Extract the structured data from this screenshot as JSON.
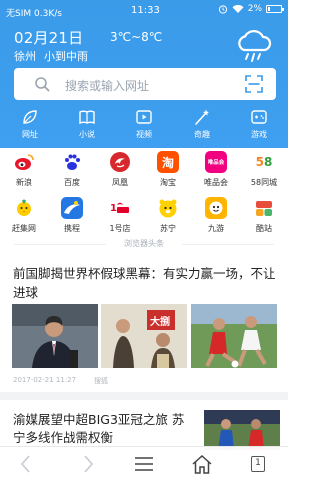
{
  "status_bar": {
    "carrier": "无SIM",
    "speed": "0.3K/s",
    "time": "11:33",
    "battery": "2%"
  },
  "weather": {
    "date": "02月21日",
    "temperature": "3℃~8℃",
    "city": "徐州",
    "condition": "小到中雨",
    "icon": "cloud-rain-icon"
  },
  "search": {
    "placeholder": "搜索或输入网址"
  },
  "nav": [
    {
      "label": "网址",
      "icon": "leaf-icon"
    },
    {
      "label": "小说",
      "icon": "book-icon"
    },
    {
      "label": "视频",
      "icon": "video-icon"
    },
    {
      "label": "奇趣",
      "icon": "magic-icon"
    },
    {
      "label": "游戏",
      "icon": "gamepad-icon"
    }
  ],
  "apps": [
    {
      "label": "新浪",
      "color": "#e6162d",
      "icon": "weibo-icon"
    },
    {
      "label": "百度",
      "color": "#2932e1",
      "icon": "baidu-paw-icon"
    },
    {
      "label": "凤凰",
      "color": "#d7282e",
      "icon": "phoenix-icon"
    },
    {
      "label": "淘宝",
      "color": "#ff5000",
      "glyph": "淘",
      "icon": "taobao-icon"
    },
    {
      "label": "唯品会",
      "color": "#f10180",
      "glyph": "唯品会",
      "icon": "vip-icon"
    },
    {
      "label": "58同城",
      "color": "#ffffff",
      "glyph": "58",
      "icon": "58-icon"
    },
    {
      "label": "赶集网",
      "color": "#32b16c",
      "icon": "ganji-icon"
    },
    {
      "label": "携程",
      "color": "#2577e3",
      "icon": "ctrip-icon"
    },
    {
      "label": "1号店",
      "color": "#ffffff",
      "icon": "yhd-icon"
    },
    {
      "label": "苏宁",
      "color": "#ffd100",
      "icon": "suning-icon"
    },
    {
      "label": "九游",
      "color": "#ffb400",
      "icon": "jiuyou-icon"
    },
    {
      "label": "酷站",
      "color": "#ffffff",
      "icon": "kuzhan-icon"
    }
  ],
  "section_title": "浏览器头条",
  "news": [
    {
      "title": "前国脚揭世界杯假球黑幕：有实力赢一场，不让进球",
      "date": "2017-02-21 11:27",
      "source": "搜狐"
    },
    {
      "title": "渝媒展望中超BIG3亚冠之旅 苏宁多线作战需权衡"
    }
  ],
  "toolbar": {
    "back": "back-icon",
    "forward": "forward-icon",
    "menu": "menu-icon",
    "home": "home-icon",
    "tab_count": "1"
  }
}
